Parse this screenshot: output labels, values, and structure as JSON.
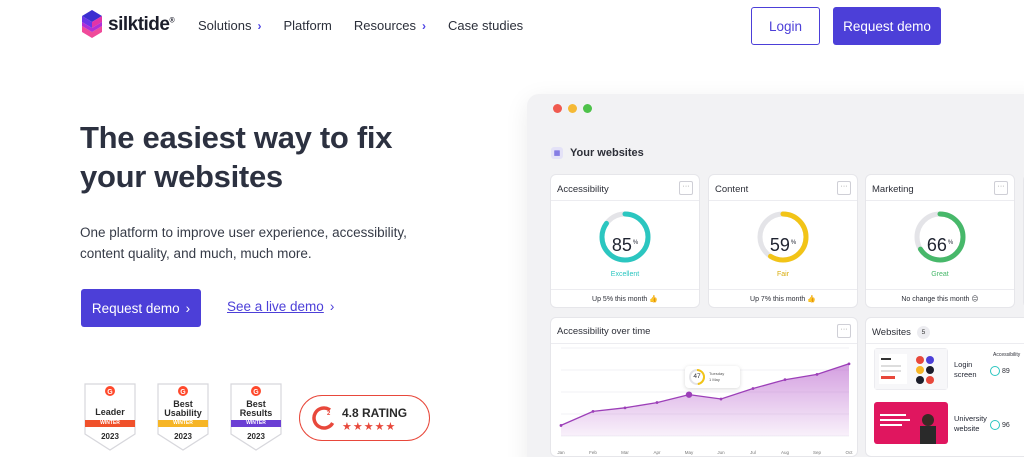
{
  "brand": {
    "name": "silktide",
    "reg": "®"
  },
  "nav": {
    "items": [
      {
        "label": "Solutions",
        "chevron": "›"
      },
      {
        "label": "Platform",
        "chevron": ""
      },
      {
        "label": "Resources",
        "chevron": "›"
      },
      {
        "label": "Case studies",
        "chevron": ""
      }
    ],
    "login_label": "Login",
    "demo_label": "Request demo"
  },
  "hero": {
    "title_line1": "The easiest way to fix",
    "title_line2": "your websites",
    "subtitle_line1": "One platform to improve user experience, accessibility,",
    "subtitle_line2": "content quality, and much, much more.",
    "cta_label": "Request demo",
    "cta_chevron": "›",
    "live_demo_label": "See a live demo",
    "live_demo_chevron": "›"
  },
  "badges": [
    {
      "line1": "Leader",
      "line2": "",
      "ribbon": "WINTER",
      "year": "2023",
      "ribbon_color": "#f0512b"
    },
    {
      "line1": "Best",
      "line2": "Usability",
      "ribbon": "WINTER",
      "year": "2023",
      "ribbon_color": "#f6b526"
    },
    {
      "line1": "Best",
      "line2": "Results",
      "ribbon": "WINTER",
      "year": "2023",
      "ribbon_color": "#6b3fd4"
    }
  ],
  "rating": {
    "label": "4.8 RATING",
    "stars": "★★★★★",
    "icon": "g2-logo-icon"
  },
  "dashboard": {
    "section_title": "Your websites",
    "cards": [
      {
        "title": "Accessibility",
        "value": "85",
        "unit": "%",
        "status": "Excellent",
        "status_color": "#2bc6c0",
        "foot": "Up 5% this month 👍",
        "fraction": 0.85
      },
      {
        "title": "Content",
        "value": "59",
        "unit": "%",
        "status": "Fair",
        "status_color": "#f2c417",
        "foot": "Up 7% this month 👍",
        "fraction": 0.59
      },
      {
        "title": "Marketing",
        "value": "66",
        "unit": "%",
        "status": "Great",
        "status_color": "#47b86a",
        "foot": "No change this month 😐",
        "fraction": 0.66
      }
    ],
    "over_time": {
      "title": "Accessibility over time",
      "tooltip_value": "47",
      "tooltip_line1": "Tuesday",
      "tooltip_line2": "1 May"
    },
    "websites": {
      "title": "Websites",
      "count": "5",
      "column_label": "Accessibility",
      "rows": [
        {
          "name_line1": "Login",
          "name_line2": "screen",
          "score": "89"
        },
        {
          "name_line1": "University",
          "name_line2": "website",
          "score": "96"
        }
      ]
    }
  },
  "chart_data": {
    "type": "area",
    "categories": [
      "Jan",
      "Feb",
      "Mar",
      "Apr",
      "May",
      "Jun",
      "Jul",
      "Aug",
      "Sep",
      "Oct"
    ],
    "values": [
      12,
      28,
      32,
      38,
      47,
      42,
      54,
      64,
      70,
      82
    ],
    "title": "Accessibility over time",
    "xlabel": "",
    "ylabel": "",
    "ylim": [
      0,
      100
    ],
    "color": "#b04fc7"
  },
  "colors": {
    "accent": "#4c3fd8",
    "g2": "#e8483b"
  }
}
